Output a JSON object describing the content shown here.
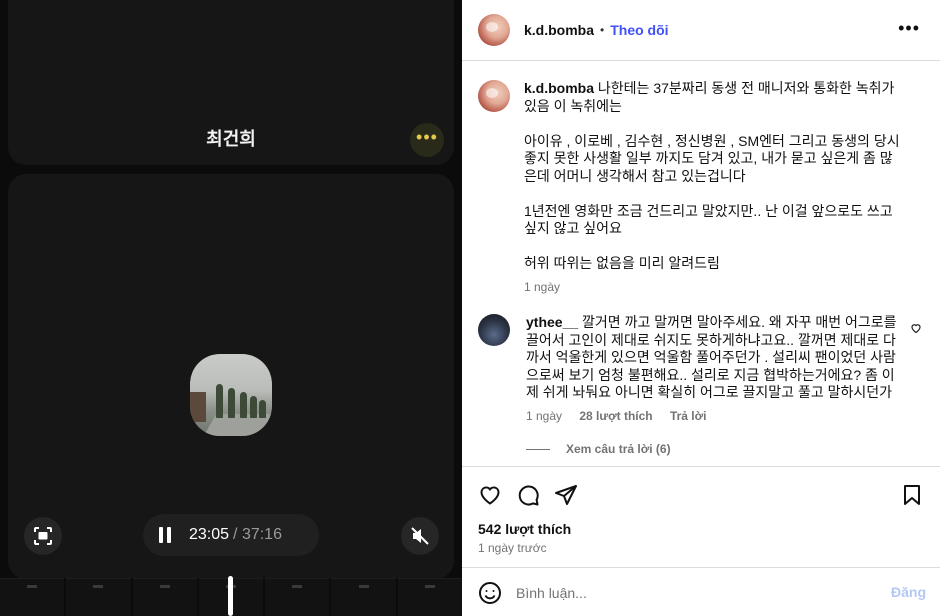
{
  "media": {
    "title": "최건희",
    "current_time": "23:05",
    "total_time": "/ 37:16"
  },
  "post": {
    "username": "k.d.bomba",
    "separator": "•",
    "follow_label": "Theo dõi",
    "options_label": "•••",
    "caption": {
      "line1": "나한테는 37분짜리 동생 전 매니저와 통화한 녹취가 있음 이 녹취에는",
      "para2": "아이유 , 이로베 , 김수현 , 정신병원 , SM엔터 그리고 동생의 당시 좋지 못한 사생활 일부 까지도 담겨 있고, 내가 묻고 싶은게 좀 많은데 어머니 생각해서 참고 있는겁니다",
      "para3": "1년전엔 영화만 조금 건드리고 말았지만.. 난 이걸 앞으로도 쓰고 싶지 않고 싶어요",
      "para4": "허위 따위는 없음을 미리 알려드림",
      "time": "1 ngày"
    },
    "comment": {
      "username": "ythee__",
      "text": "깔거면 까고 말꺼면 말아주세요. 왜 자꾸 매번 어그로를 끌어서 고인이 제대로 쉬지도 못하게하냐고요.. 깔꺼면 제대로 다 까서 억울한게 있으면 억울함 풀어주던가 . 설리씨 팬이었던 사람으로써 보기 엄청 불편해요.. 설리로 지금 협박하는거에요? 좀 이제 쉬게 놔둬요 아니면 확실히 어그로 끌지말고 풀고 말하시던가",
      "time": "1 ngày",
      "likes": "28 lượt thích",
      "reply_label": "Trả lời",
      "view_replies": "Xem câu trả lời (6)"
    },
    "likes_count": "542 lượt thích",
    "posted_ago": "1 ngày trước",
    "comment_input": {
      "placeholder": "Bình luận...",
      "post_label": "Đăng"
    }
  }
}
